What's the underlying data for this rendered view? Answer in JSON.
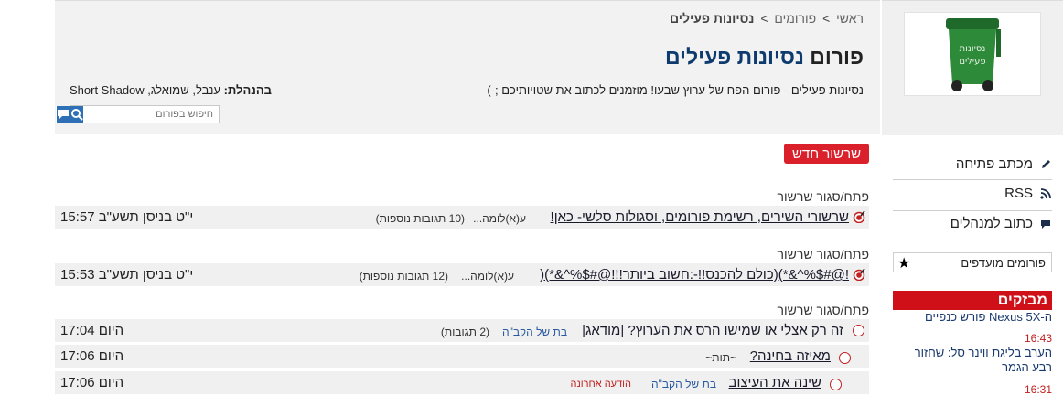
{
  "breadcrumb": {
    "home": "ראשי",
    "forums": "פורומים",
    "current": "נסיונות פעילים",
    "sep": ">"
  },
  "forum": {
    "title_word1": "פורום",
    "title_word2": "נסיונות פעילים",
    "description": "נסיונות פעילים - פורום הפח של ערוץ שבעו! מוזמנים לכתוב את שטויותיכם ;-)",
    "moderators_label": "בהנהלת:",
    "moderators": "ענבל, שמואלג, Short Shadow"
  },
  "search": {
    "placeholder": "חיפוש בפורום"
  },
  "sidebar": {
    "logo_text": "נסיונות פעילים",
    "links": [
      {
        "label": "מכתב פתיחה",
        "icon": "pencil-icon"
      },
      {
        "label": "RSS",
        "icon": "rss-icon"
      },
      {
        "label": "כתוב למנהלים",
        "icon": "chat-icon"
      }
    ],
    "favorites": "פורומים מועדפים",
    "news_head": "מבזקים",
    "news": [
      {
        "text": "ה-Nexus 5X פורש כנפיים",
        "time": "16:43"
      },
      {
        "text": "הערב בליגת ווינר סל: שחזור רבע הגמר",
        "time": "16:31"
      }
    ]
  },
  "main": {
    "new_thread": "שרשור חדש",
    "toggle": "פתח/סגור שרשור",
    "threads": [
      {
        "title": "שרשורי השירים, רשימת פורומים, וסגולות סלשי- כאן!",
        "author": "ע(א)לומה...",
        "replies": "(10 תגובות נוספות)",
        "date": "י\"ט בניסן תשע\"ב 15:57"
      },
      {
        "title": "!@#$%^&*)(כולם להכנס!!-:חשוב ביותר!!!@#$%^&*)(",
        "author": "ע(א)לומה...",
        "replies": "(12 תגובות נוספות)",
        "date": "י\"ט בניסן תשע\"ב 15:53"
      },
      {
        "title": "זה רק אצלי או שמישו הרס את הערוץ? |מודאג|",
        "author": "בת של הקב\"ה",
        "replies": "(2 תגובות)",
        "date": "היום 17:04"
      },
      {
        "title": "מאיזה בחינה?",
        "author": "~תות~",
        "date": "היום 17:06"
      },
      {
        "title": "שינה את העיצוב",
        "author": "בת של הקב\"ה",
        "lastmsg": "הודעה אחרונה",
        "date": "היום 17:06"
      }
    ]
  },
  "colors": {
    "accent_red": "#d9202b",
    "navy": "#0e3b6e",
    "button_blue": "#2d70b5"
  }
}
